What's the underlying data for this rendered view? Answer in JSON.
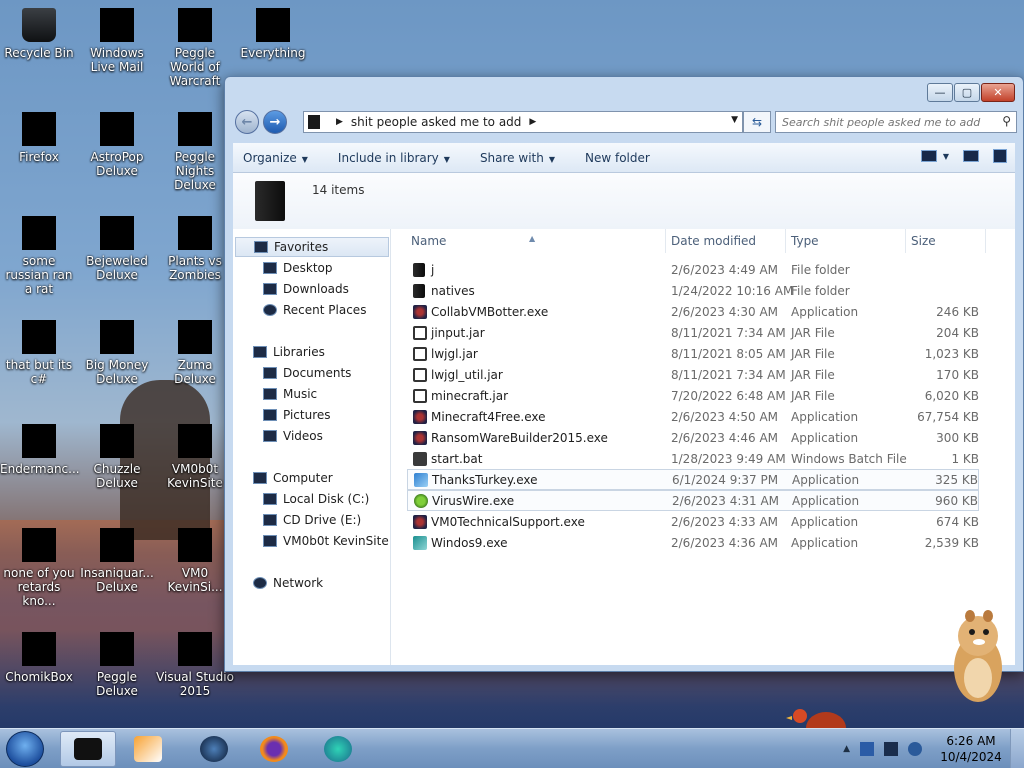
{
  "desktop": {
    "icons": [
      {
        "label": "Recycle Bin",
        "icon": "recycle-bin-icon"
      },
      {
        "label": "Windows Live Mail",
        "icon": "mail-icon"
      },
      {
        "label": "Peggle World of Warcraft",
        "icon": "game-icon"
      },
      {
        "label": "Everything",
        "icon": "search-app-icon"
      },
      {
        "label": "Firefox",
        "icon": "firefox-icon"
      },
      {
        "label": "AstroPop Deluxe",
        "icon": "game-icon"
      },
      {
        "label": "Peggle Nights Deluxe",
        "icon": "game-icon"
      },
      {
        "label": "some russian ran a rat",
        "icon": "shortcut-icon"
      },
      {
        "label": "Bejeweled Deluxe",
        "icon": "game-icon"
      },
      {
        "label": "Plants vs Zombies",
        "icon": "game-icon"
      },
      {
        "label": "that but its c#",
        "icon": "shortcut-icon"
      },
      {
        "label": "Big Money Deluxe",
        "icon": "game-icon"
      },
      {
        "label": "Zuma Deluxe",
        "icon": "game-icon"
      },
      {
        "label": "Endermanc...",
        "icon": "shortcut-icon"
      },
      {
        "label": "Chuzzle Deluxe",
        "icon": "game-icon"
      },
      {
        "label": "VM0b0t KevinSite",
        "icon": "shortcut-icon"
      },
      {
        "label": "none of you retards kno...",
        "icon": "shortcut-icon"
      },
      {
        "label": "Insaniquar... Deluxe",
        "icon": "game-icon"
      },
      {
        "label": "VM0 KevinSi...",
        "icon": "shortcut-icon"
      },
      {
        "label": "ChomikBox",
        "icon": "app-icon"
      },
      {
        "label": "Peggle Deluxe",
        "icon": "game-icon"
      },
      {
        "label": "Visual Studio 2015",
        "icon": "visual-studio-icon"
      }
    ]
  },
  "explorer": {
    "address": {
      "segment": "shit people asked me to add"
    },
    "search": {
      "placeholder": "Search shit people asked me to add"
    },
    "toolbar": {
      "organize": "Organize",
      "include": "Include in library",
      "share": "Share with",
      "new_folder": "New folder"
    },
    "item_count": "14 items",
    "nav": {
      "favorites": "Favorites",
      "desktop": "Desktop",
      "downloads": "Downloads",
      "recent": "Recent Places",
      "libraries": "Libraries",
      "documents": "Documents",
      "music": "Music",
      "pictures": "Pictures",
      "videos": "Videos",
      "computer": "Computer",
      "local_disk": "Local Disk (C:)",
      "cd_drive": "CD Drive (E:)",
      "vm0b0t": "VM0b0t KevinSite",
      "network": "Network"
    },
    "columns": {
      "name": "Name",
      "date": "Date modified",
      "type": "Type",
      "size": "Size"
    },
    "files": [
      {
        "name": "j",
        "date": "2/6/2023 4:49 AM",
        "type": "File folder",
        "size": "",
        "icon": "folder"
      },
      {
        "name": "natives",
        "date": "1/24/2022 10:16 AM",
        "type": "File folder",
        "size": "",
        "icon": "folder"
      },
      {
        "name": "CollabVMBotter.exe",
        "date": "2/6/2023 4:30 AM",
        "type": "Application",
        "size": "246 KB",
        "icon": "app"
      },
      {
        "name": "jinput.jar",
        "date": "8/11/2021 7:34 AM",
        "type": "JAR File",
        "size": "204 KB",
        "icon": "jar"
      },
      {
        "name": "lwjgl.jar",
        "date": "8/11/2021 8:05 AM",
        "type": "JAR File",
        "size": "1,023 KB",
        "icon": "jar"
      },
      {
        "name": "lwjgl_util.jar",
        "date": "8/11/2021 7:34 AM",
        "type": "JAR File",
        "size": "170 KB",
        "icon": "jar"
      },
      {
        "name": "minecraft.jar",
        "date": "7/20/2022 6:48 AM",
        "type": "JAR File",
        "size": "6,020 KB",
        "icon": "jar"
      },
      {
        "name": "Minecraft4Free.exe",
        "date": "2/6/2023 4:50 AM",
        "type": "Application",
        "size": "67,754 KB",
        "icon": "app"
      },
      {
        "name": "RansomWareBuilder2015.exe",
        "date": "2/6/2023 4:46 AM",
        "type": "Application",
        "size": "300 KB",
        "icon": "app"
      },
      {
        "name": "start.bat",
        "date": "1/28/2023 9:49 AM",
        "type": "Windows Batch File",
        "size": "1 KB",
        "icon": "bat"
      },
      {
        "name": "ThanksTurkey.exe",
        "date": "6/1/2024 9:37 PM",
        "type": "Application",
        "size": "325 KB",
        "icon": "blue"
      },
      {
        "name": "VirusWire.exe",
        "date": "2/6/2023 4:31 AM",
        "type": "Application",
        "size": "960 KB",
        "icon": "green"
      },
      {
        "name": "VM0TechnicalSupport.exe",
        "date": "2/6/2023 4:33 AM",
        "type": "Application",
        "size": "674 KB",
        "icon": "app"
      },
      {
        "name": "Windos9.exe",
        "date": "2/6/2023 4:36 AM",
        "type": "Application",
        "size": "2,539 KB",
        "icon": "teal"
      }
    ]
  },
  "taskbar": {
    "time": "6:26 AM",
    "date": "10/4/2024",
    "apps": [
      "explorer-icon",
      "media-player-icon",
      "game-icon",
      "firefox-icon",
      "app-icon"
    ]
  }
}
